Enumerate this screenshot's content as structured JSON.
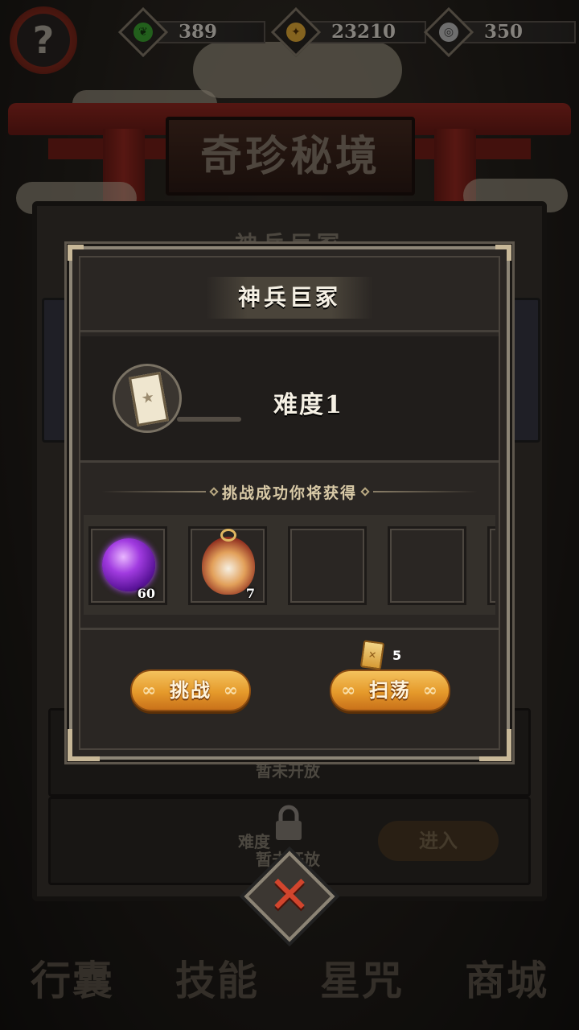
{
  "resources": [
    {
      "icon": "jade-leaf-icon",
      "value": "389",
      "color": "#4ec640"
    },
    {
      "icon": "gold-coin-icon",
      "value": "23210",
      "color": "#f0b53a"
    },
    {
      "icon": "silver-coin-icon",
      "value": "350",
      "color": "#c9c9c9"
    }
  ],
  "help": {
    "label": "?"
  },
  "background": {
    "banner_title": "奇珍秘境",
    "panel_title": "神兵巨冢",
    "row_locked_text": "暂未开放",
    "row2_difficulty": "难度",
    "enter_label": "进入"
  },
  "nav": [
    "行囊",
    "技能",
    "星咒",
    "商城"
  ],
  "modal": {
    "title": "神兵巨冢",
    "difficulty": "难度1",
    "reward_header": "挑战成功你将获得",
    "rewards": [
      {
        "name": "purple-orb-icon",
        "qty": "60"
      },
      {
        "name": "monkey-medal-icon",
        "qty": "7"
      },
      {
        "name": "empty-slot",
        "qty": ""
      },
      {
        "name": "empty-slot",
        "qty": ""
      },
      {
        "name": "empty-slot",
        "qty": ""
      }
    ],
    "challenge_label": "挑战",
    "sweep_label": "扫荡",
    "sweep_cost": "5"
  },
  "close": {
    "label": "✕"
  }
}
